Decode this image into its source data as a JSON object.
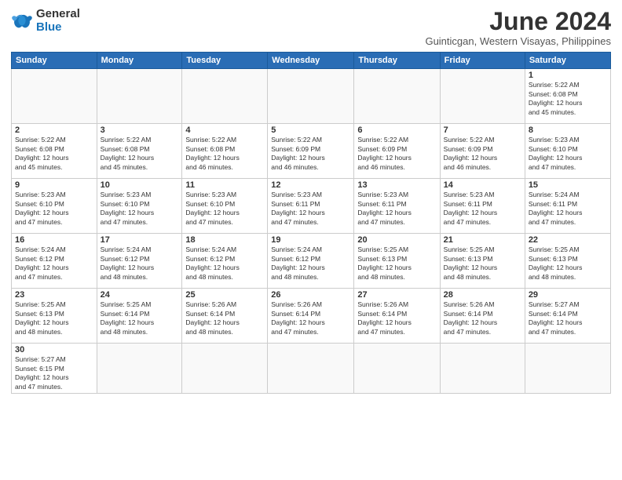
{
  "logo": {
    "general": "General",
    "blue": "Blue"
  },
  "title": "June 2024",
  "subtitle": "Guinticgan, Western Visayas, Philippines",
  "weekdays": [
    "Sunday",
    "Monday",
    "Tuesday",
    "Wednesday",
    "Thursday",
    "Friday",
    "Saturday"
  ],
  "days": {
    "1": "Sunrise: 5:22 AM\nSunset: 6:08 PM\nDaylight: 12 hours\nand 45 minutes.",
    "2": "Sunrise: 5:22 AM\nSunset: 6:08 PM\nDaylight: 12 hours\nand 45 minutes.",
    "3": "Sunrise: 5:22 AM\nSunset: 6:08 PM\nDaylight: 12 hours\nand 45 minutes.",
    "4": "Sunrise: 5:22 AM\nSunset: 6:08 PM\nDaylight: 12 hours\nand 46 minutes.",
    "5": "Sunrise: 5:22 AM\nSunset: 6:09 PM\nDaylight: 12 hours\nand 46 minutes.",
    "6": "Sunrise: 5:22 AM\nSunset: 6:09 PM\nDaylight: 12 hours\nand 46 minutes.",
    "7": "Sunrise: 5:22 AM\nSunset: 6:09 PM\nDaylight: 12 hours\nand 46 minutes.",
    "8": "Sunrise: 5:23 AM\nSunset: 6:10 PM\nDaylight: 12 hours\nand 47 minutes.",
    "9": "Sunrise: 5:23 AM\nSunset: 6:10 PM\nDaylight: 12 hours\nand 47 minutes.",
    "10": "Sunrise: 5:23 AM\nSunset: 6:10 PM\nDaylight: 12 hours\nand 47 minutes.",
    "11": "Sunrise: 5:23 AM\nSunset: 6:10 PM\nDaylight: 12 hours\nand 47 minutes.",
    "12": "Sunrise: 5:23 AM\nSunset: 6:11 PM\nDaylight: 12 hours\nand 47 minutes.",
    "13": "Sunrise: 5:23 AM\nSunset: 6:11 PM\nDaylight: 12 hours\nand 47 minutes.",
    "14": "Sunrise: 5:23 AM\nSunset: 6:11 PM\nDaylight: 12 hours\nand 47 minutes.",
    "15": "Sunrise: 5:24 AM\nSunset: 6:11 PM\nDaylight: 12 hours\nand 47 minutes.",
    "16": "Sunrise: 5:24 AM\nSunset: 6:12 PM\nDaylight: 12 hours\nand 47 minutes.",
    "17": "Sunrise: 5:24 AM\nSunset: 6:12 PM\nDaylight: 12 hours\nand 48 minutes.",
    "18": "Sunrise: 5:24 AM\nSunset: 6:12 PM\nDaylight: 12 hours\nand 48 minutes.",
    "19": "Sunrise: 5:24 AM\nSunset: 6:12 PM\nDaylight: 12 hours\nand 48 minutes.",
    "20": "Sunrise: 5:25 AM\nSunset: 6:13 PM\nDaylight: 12 hours\nand 48 minutes.",
    "21": "Sunrise: 5:25 AM\nSunset: 6:13 PM\nDaylight: 12 hours\nand 48 minutes.",
    "22": "Sunrise: 5:25 AM\nSunset: 6:13 PM\nDaylight: 12 hours\nand 48 minutes.",
    "23": "Sunrise: 5:25 AM\nSunset: 6:13 PM\nDaylight: 12 hours\nand 48 minutes.",
    "24": "Sunrise: 5:25 AM\nSunset: 6:14 PM\nDaylight: 12 hours\nand 48 minutes.",
    "25": "Sunrise: 5:26 AM\nSunset: 6:14 PM\nDaylight: 12 hours\nand 48 minutes.",
    "26": "Sunrise: 5:26 AM\nSunset: 6:14 PM\nDaylight: 12 hours\nand 47 minutes.",
    "27": "Sunrise: 5:26 AM\nSunset: 6:14 PM\nDaylight: 12 hours\nand 47 minutes.",
    "28": "Sunrise: 5:26 AM\nSunset: 6:14 PM\nDaylight: 12 hours\nand 47 minutes.",
    "29": "Sunrise: 5:27 AM\nSunset: 6:14 PM\nDaylight: 12 hours\nand 47 minutes.",
    "30": "Sunrise: 5:27 AM\nSunset: 6:15 PM\nDaylight: 12 hours\nand 47 minutes."
  }
}
